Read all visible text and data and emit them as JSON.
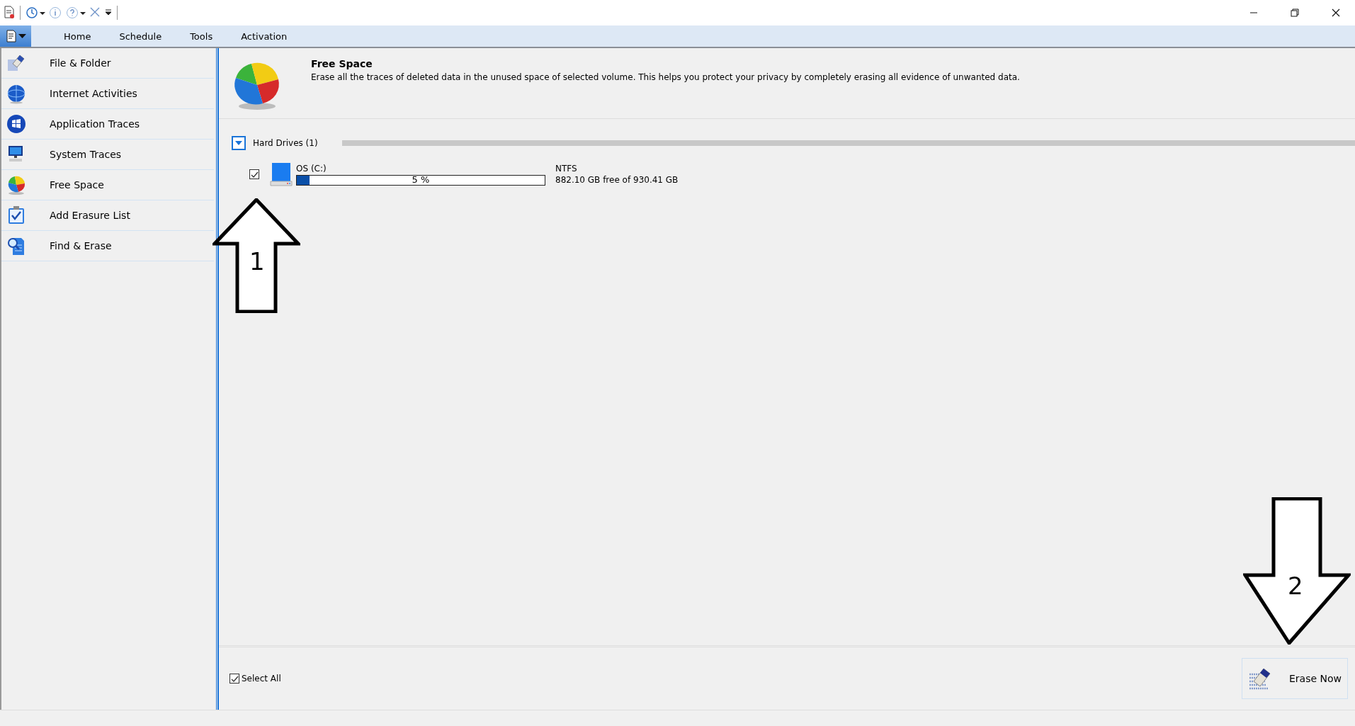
{
  "quick_access": [
    {
      "kind": "document"
    },
    {
      "kind": "schedule",
      "dropdown": true
    },
    {
      "kind": "info"
    },
    {
      "kind": "help",
      "dropdown": true
    },
    {
      "kind": "close"
    },
    {
      "kind": "customize"
    }
  ],
  "ribbon": {
    "tabs": [
      {
        "label": "Home"
      },
      {
        "label": "Schedule"
      },
      {
        "label": "Tools"
      },
      {
        "label": "Activation"
      }
    ]
  },
  "sidebar": {
    "items": [
      {
        "label": "File & Folder",
        "kind": "eraser"
      },
      {
        "label": "Internet Activities",
        "kind": "globe"
      },
      {
        "label": "Application Traces",
        "kind": "windows"
      },
      {
        "label": "System Traces",
        "kind": "monitor"
      },
      {
        "label": "Free Space",
        "kind": "pie"
      },
      {
        "label": "Add Erasure List",
        "kind": "clipboard"
      },
      {
        "label": "Find & Erase",
        "kind": "find"
      }
    ]
  },
  "header": {
    "title": "Free Space",
    "description": "Erase all the traces of deleted data in the unused space of selected volume. This helps you protect your privacy by completely erasing all evidence of unwanted data."
  },
  "group": {
    "label": "Hard Drives (1)",
    "expanded": true
  },
  "drives": [
    {
      "name": "OS (C:)",
      "checked": true,
      "level": 0.05,
      "percent": "5 %",
      "filesystem": "NTFS",
      "space": "882.10 GB free of 930.41 GB"
    }
  ],
  "select_all": {
    "label": "Select All",
    "checked": true
  },
  "erase_button": {
    "label": "Erase Now"
  },
  "annotations": [
    {
      "label": "1",
      "kind": "up"
    },
    {
      "label": "2",
      "kind": "down"
    }
  ]
}
